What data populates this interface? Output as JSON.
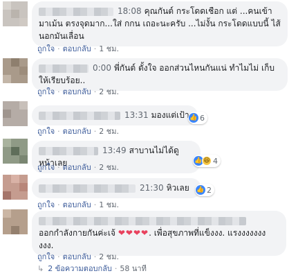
{
  "ui": {
    "like_label": "ถูกใจ",
    "reply_label": "ตอบกลับ",
    "separator": "·"
  },
  "comments": [
    {
      "time_tag": "18:08",
      "text": "คุณกันต์ กระโดดเชือก แต่ ...คนเข้ามาเม้น ตรงจุดมาก...ใส่ กกน เถอะนะครับ ...ไม่งั้น กระโดดแบบนี้ ไส้นอกมันเลื่อน",
      "age": "1 ชม."
    },
    {
      "time_tag": "0:00",
      "text": "พี่กันต์ ตั้งใจ ออกส่วนไหนกันแน่ ทำไมไม่ เก็บให้เรียบร้อย..",
      "age": "2 ชม."
    },
    {
      "time_tag": "13:31",
      "text": "มองแต่เป้า",
      "age": "2 ชม.",
      "reaction_count": "6"
    },
    {
      "time_tag": "13:49",
      "text": "สาบานไม่ได้ดูหน้าเลย",
      "age": "2 ชม.",
      "reaction_count": "4"
    },
    {
      "time_tag": "21:30",
      "text": "หิวเลย",
      "age": "1 ชม.",
      "reaction_count": "2"
    },
    {
      "text_pre": "ออกกำลังกายกันค่ะเจ้",
      "hearts": "❤❤❤❤",
      "text_post": ". เพื่อสุขภาพที่แข็งงง. แรงงงงงงงงงง.",
      "age": "2 ชม."
    }
  ],
  "replies": {
    "label": "2 ข้อความตอบกลับ",
    "age": "58 นาที"
  },
  "colors": {
    "bubble": "#f2f3f5",
    "link": "#385898",
    "meta": "#606770",
    "like": "#3a86ff",
    "haha": "#f7c744",
    "heart": "#e8415d"
  }
}
